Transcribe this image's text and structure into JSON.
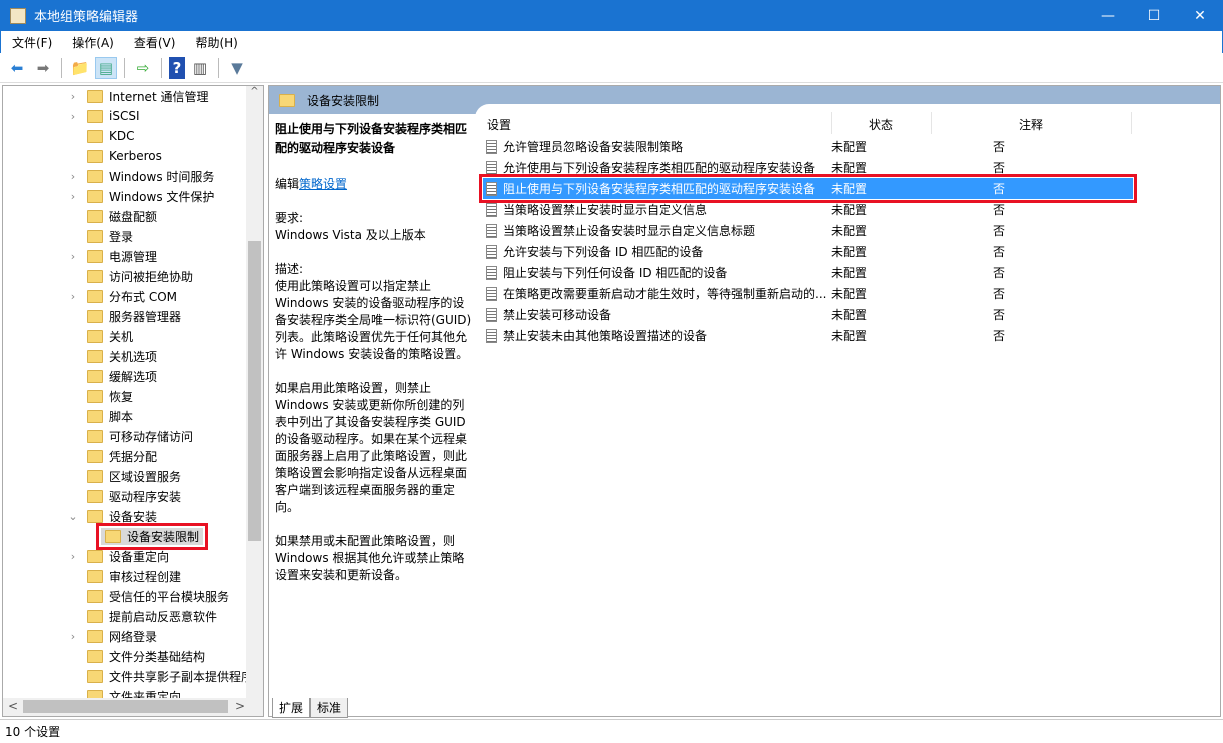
{
  "window": {
    "title": "本地组策略编辑器",
    "controls": [
      "—",
      "☐",
      "✕"
    ]
  },
  "menu": [
    "文件(F)",
    "操作(A)",
    "查看(V)",
    "帮助(H)"
  ],
  "toolbar": [
    "back-icon",
    "forward-icon",
    "up-folder-icon",
    "show-hide-tree-icon",
    "export-list-icon",
    "help-icon",
    "show-action-pane-icon",
    "filter-icon"
  ],
  "tree": {
    "items": [
      {
        "label": "Internet 通信管理",
        "expander": ">"
      },
      {
        "label": "iSCSI",
        "expander": ">"
      },
      {
        "label": "KDC",
        "expander": ""
      },
      {
        "label": "Kerberos",
        "expander": ""
      },
      {
        "label": "Windows 时间服务",
        "expander": ">"
      },
      {
        "label": "Windows 文件保护",
        "expander": ">"
      },
      {
        "label": "磁盘配额",
        "expander": ""
      },
      {
        "label": "登录",
        "expander": ""
      },
      {
        "label": "电源管理",
        "expander": ">"
      },
      {
        "label": "访问被拒绝协助",
        "expander": ""
      },
      {
        "label": "分布式 COM",
        "expander": ">"
      },
      {
        "label": "服务器管理器",
        "expander": ""
      },
      {
        "label": "关机",
        "expander": ""
      },
      {
        "label": "关机选项",
        "expander": ""
      },
      {
        "label": "缓解选项",
        "expander": ""
      },
      {
        "label": "恢复",
        "expander": ""
      },
      {
        "label": "脚本",
        "expander": ""
      },
      {
        "label": "可移动存储访问",
        "expander": ""
      },
      {
        "label": "凭据分配",
        "expander": ""
      },
      {
        "label": "区域设置服务",
        "expander": ""
      },
      {
        "label": "驱动程序安装",
        "expander": ""
      },
      {
        "label": "设备安装",
        "expander": "v"
      },
      {
        "label": "设备安装限制",
        "expander": "",
        "child": true,
        "selected": true
      },
      {
        "label": "设备重定向",
        "expander": ">"
      },
      {
        "label": "审核过程创建",
        "expander": ""
      },
      {
        "label": "受信任的平台模块服务",
        "expander": ""
      },
      {
        "label": "提前启动反恶意软件",
        "expander": ""
      },
      {
        "label": "网络登录",
        "expander": ">"
      },
      {
        "label": "文件分类基础结构",
        "expander": ""
      },
      {
        "label": "文件共享影子副本提供程序",
        "expander": ""
      },
      {
        "label": "文件夹重定向",
        "expander": ""
      }
    ]
  },
  "panel": {
    "header": "设备安装限制",
    "desc": {
      "title": "阻止使用与下列设备安装程序类相匹配的驱动程序安装设备",
      "edit_prefix": "编辑",
      "edit_link": "策略设置",
      "req_label": "要求:",
      "req_value": "Windows Vista 及以上版本",
      "desc_label": "描述:",
      "p1": "使用此策略设置可以指定禁止 Windows 安装的设备驱动程序的设备安装程序类全局唯一标识符(GUID)列表。此策略设置优先于任何其他允许 Windows 安装设备的策略设置。",
      "p2": "如果启用此策略设置，则禁止 Windows 安装或更新你所创建的列表中列出了其设备安装程序类 GUID 的设备驱动程序。如果在某个远程桌面服务器上启用了此策略设置，则此策略设置会影响指定设备从远程桌面客户端到该远程桌面服务器的重定向。",
      "p3": "如果禁用或未配置此策略设置，则 Windows 根据其他允许或禁止策略设置来安装和更新设备。"
    },
    "columns": {
      "setting": "设置",
      "state": "状态",
      "comment": "注释"
    },
    "rows": [
      {
        "name": "允许管理员忽略设备安装限制策略",
        "state": "未配置",
        "comment": "否"
      },
      {
        "name": "允许使用与下列设备安装程序类相匹配的驱动程序安装设备",
        "state": "未配置",
        "comment": "否"
      },
      {
        "name": "阻止使用与下列设备安装程序类相匹配的驱动程序安装设备",
        "state": "未配置",
        "comment": "否",
        "selected": true
      },
      {
        "name": "当策略设置禁止安装时显示自定义信息",
        "state": "未配置",
        "comment": "否"
      },
      {
        "name": "当策略设置禁止设备安装时显示自定义信息标题",
        "state": "未配置",
        "comment": "否"
      },
      {
        "name": "允许安装与下列设备 ID 相匹配的设备",
        "state": "未配置",
        "comment": "否"
      },
      {
        "name": "阻止安装与下列任何设备 ID 相匹配的设备",
        "state": "未配置",
        "comment": "否"
      },
      {
        "name": "在策略更改需要重新启动才能生效时，等待强制重新启动的...",
        "state": "未配置",
        "comment": "否"
      },
      {
        "name": "禁止安装可移动设备",
        "state": "未配置",
        "comment": "否"
      },
      {
        "name": "禁止安装未由其他策略设置描述的设备",
        "state": "未配置",
        "comment": "否"
      }
    ]
  },
  "tabs": [
    "扩展",
    "标准"
  ],
  "status": "10 个设置",
  "colors": {
    "titlebar": "#1a73d1",
    "selection": "#3399ff",
    "highlight_box": "#e81123",
    "panel_header": "#9bb5d3"
  }
}
